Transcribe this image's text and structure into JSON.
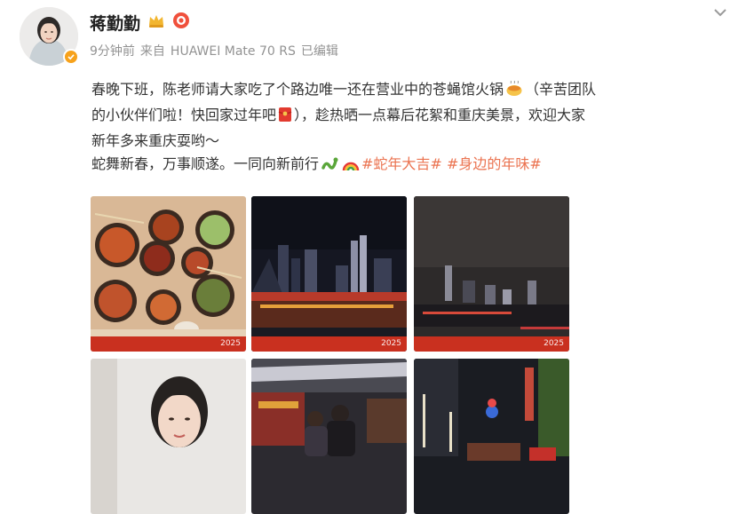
{
  "author": {
    "name": "蒋勤勤",
    "avatar_icon": "avatar-photo",
    "verified_icon": "verified-badge-icon",
    "crown_icon": "crown-icon",
    "vip_icon": "vip-badge-icon"
  },
  "meta": {
    "time": "9分钟前",
    "source_prefix": "来自",
    "device": "HUAWEI Mate 70 RS",
    "edited": "已编辑"
  },
  "post": {
    "line1": "春晚下班，陈老师请大家吃了个路边唯一还在营业中的苍蝇馆火锅",
    "line1b": "（辛苦团队",
    "line2": "的小伙伴们啦！快回家过年吧",
    "line2b": "），趁热晒一点幕后花絮和重庆美景，欢迎大家",
    "line3": "新年多来重庆耍哟～",
    "line4": "蛇舞新春，万事顺遂。一同向新前行",
    "hashtag1": "#蛇年大吉#",
    "hashtag2": "#身边的年味#"
  },
  "photos": {
    "watermark": "2025",
    "items": [
      {
        "name": "hotpot-photo",
        "alt": "hotpot"
      },
      {
        "name": "night-skyline-photo",
        "alt": "skyline"
      },
      {
        "name": "night-river-photo",
        "alt": "river"
      },
      {
        "name": "selfie-photo",
        "alt": "selfie"
      },
      {
        "name": "street-photo",
        "alt": "street"
      },
      {
        "name": "night-street-photo",
        "alt": "night street"
      }
    ]
  },
  "colors": {
    "hashtag": "#eb7350",
    "meta_text": "#939393",
    "verified": "#f7a21b"
  }
}
